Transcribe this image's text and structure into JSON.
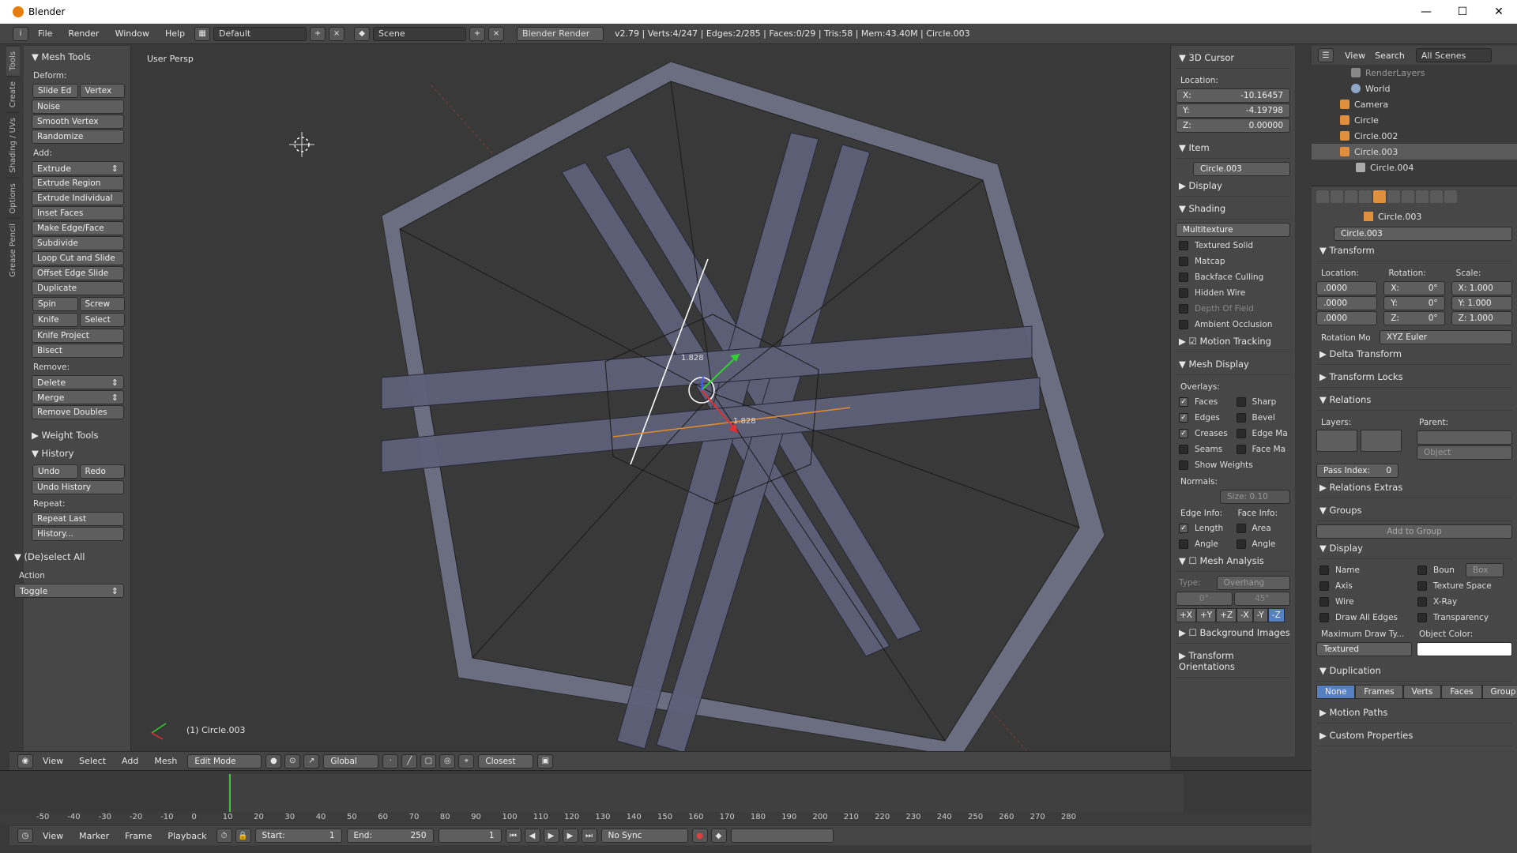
{
  "window": {
    "title": "Blender",
    "min": "—",
    "max": "☐",
    "close": "✕"
  },
  "infobar": {
    "menus": [
      "File",
      "Render",
      "Window",
      "Help"
    ],
    "layout": "Default",
    "scene": "Scene",
    "engine": "Blender Render",
    "stats": "v2.79 | Verts:4/247 | Edges:2/285 | Faces:0/29 | Tris:58 | Mem:43.40M | Circle.003"
  },
  "tooltabs": [
    "Tools",
    "Create",
    "Shading / UVs",
    "Options",
    "Grease Pencil"
  ],
  "tools": {
    "mesh_tools": "Mesh Tools",
    "deform": "Deform:",
    "slide_ed": "Slide Ed",
    "vertex": "Vertex",
    "noise": "Noise",
    "smooth_vertex": "Smooth Vertex",
    "randomize": "Randomize",
    "add": "Add:",
    "extrude": "Extrude",
    "extrude_region": "Extrude Region",
    "extrude_individual": "Extrude Individual",
    "inset_faces": "Inset Faces",
    "make_edge_face": "Make Edge/Face",
    "subdivide": "Subdivide",
    "loop_cut": "Loop Cut and Slide",
    "offset_edge": "Offset Edge Slide",
    "duplicate": "Duplicate",
    "spin": "Spin",
    "screw": "Screw",
    "knife": "Knife",
    "select": "Select",
    "knife_project": "Knife Project",
    "bisect": "Bisect",
    "remove": "Remove:",
    "delete": "Delete",
    "merge": "Merge",
    "remove_doubles": "Remove Doubles",
    "weight_tools": "Weight Tools",
    "history": "History",
    "undo": "Undo",
    "redo": "Redo",
    "undo_history": "Undo History",
    "repeat": "Repeat:",
    "repeat_last": "Repeat Last",
    "history_dots": "History...",
    "deselect_all": "(De)select All",
    "action": "Action",
    "toggle": "Toggle"
  },
  "viewport": {
    "label": "User Persp",
    "object": "(1) Circle.003",
    "edge_len_a": "1.828",
    "edge_len_b": "1.828"
  },
  "vheader": {
    "view": "View",
    "select": "Select",
    "add": "Add",
    "mesh": "Mesh",
    "mode": "Edit Mode",
    "orientation": "Global",
    "snap": "Closest"
  },
  "npanel": {
    "cursor": "3D Cursor",
    "location": "Location:",
    "x_label": "X:",
    "x": "-10.16457",
    "y_label": "Y:",
    "y": "-4.19798",
    "z_label": "Z:",
    "z": "0.00000",
    "item": "Item",
    "item_name": "Circle.003",
    "display": "Display",
    "shading": "Shading",
    "shading_mode": "Multitexture",
    "textured_solid": "Textured Solid",
    "matcap": "Matcap",
    "backface": "Backface Culling",
    "hidden_wire": "Hidden Wire",
    "dof": "Depth Of Field",
    "ao": "Ambient Occlusion",
    "motion_tracking": "Motion Tracking",
    "mesh_display": "Mesh Display",
    "overlays": "Overlays:",
    "faces": "Faces",
    "sharp": "Sharp",
    "edges": "Edges",
    "bevel": "Bevel",
    "creases": "Creases",
    "edge_ma": "Edge Ma",
    "seams": "Seams",
    "face_ma": "Face Ma",
    "show_weights": "Show Weights",
    "normals": "Normals:",
    "size": "Size:  0.10",
    "edge_info": "Edge Info:",
    "face_info": "Face Info:",
    "length": "Length",
    "area": "Area",
    "angle1": "Angle",
    "angle2": "Angle",
    "mesh_analysis": "Mesh Analysis",
    "type": "Type:",
    "type_val": "Overhang",
    "deg0": "0°",
    "deg45": "45°",
    "axes": [
      "+X",
      "+Y",
      "+Z",
      "-X",
      "-Y",
      "-Z"
    ],
    "background_images": "Background Images",
    "transform_orient": "Transform Orientations"
  },
  "outliner": {
    "view": "View",
    "search": "Search",
    "all_scenes": "All Scenes",
    "rows": [
      "RenderLayers",
      "World",
      "Camera",
      "Circle",
      "Circle.002",
      "Circle.003",
      "Circle.004"
    ]
  },
  "props": {
    "object_name": "Circle.003",
    "object_field": "Circle.003",
    "transform": "Transform",
    "location": "Location:",
    "rotation": "Rotation:",
    "scale": "Scale:",
    "loc": [
      ".0000",
      ".0000",
      ".0000"
    ],
    "rot_x": "X:",
    "rot_y": "Y:",
    "rot_z": "Z:",
    "rot_val": "0°",
    "sc_x": "X: 1.000",
    "sc_y": "Y: 1.000",
    "sc_z": "Z: 1.000",
    "rotation_mode": "Rotation Mo",
    "rotation_mode_val": "XYZ Euler",
    "delta": "Delta Transform",
    "locks": "Transform Locks",
    "relations": "Relations",
    "layers": "Layers:",
    "parent": "Parent:",
    "object_ph": "Object",
    "pass_index": "Pass Index:",
    "pass_val": "0",
    "relations_extras": "Relations Extras",
    "groups": "Groups",
    "add_group": "Add to Group",
    "display": "Display",
    "name": "Name",
    "boun": "Boun",
    "box": "Box",
    "axis": "Axis",
    "texture_space": "Texture Space",
    "wire": "Wire",
    "xray": "X-Ray",
    "draw_all": "Draw All Edges",
    "transparency": "Transparency",
    "max_draw": "Maximum Draw Ty...",
    "object_color": "Object Color:",
    "textured": "Textured",
    "duplication": "Duplication",
    "dup": [
      "None",
      "Frames",
      "Verts",
      "Faces",
      "Group"
    ],
    "motion_paths": "Motion Paths",
    "custom_props": "Custom Properties"
  },
  "timeline": {
    "ticks": [
      "-50",
      "-40",
      "-30",
      "-20",
      "-10",
      "0",
      "10",
      "20",
      "30",
      "40",
      "50",
      "60",
      "70",
      "80",
      "90",
      "100",
      "110",
      "120",
      "130",
      "140",
      "150",
      "160",
      "170",
      "180",
      "190",
      "200",
      "210",
      "220",
      "230",
      "240",
      "250",
      "260",
      "270",
      "280"
    ],
    "view": "View",
    "marker": "Marker",
    "frame": "Frame",
    "playback": "Playback",
    "start": "Start:",
    "start_val": "1",
    "end": "End:",
    "end_val": "250",
    "current": "1",
    "sync": "No Sync"
  }
}
